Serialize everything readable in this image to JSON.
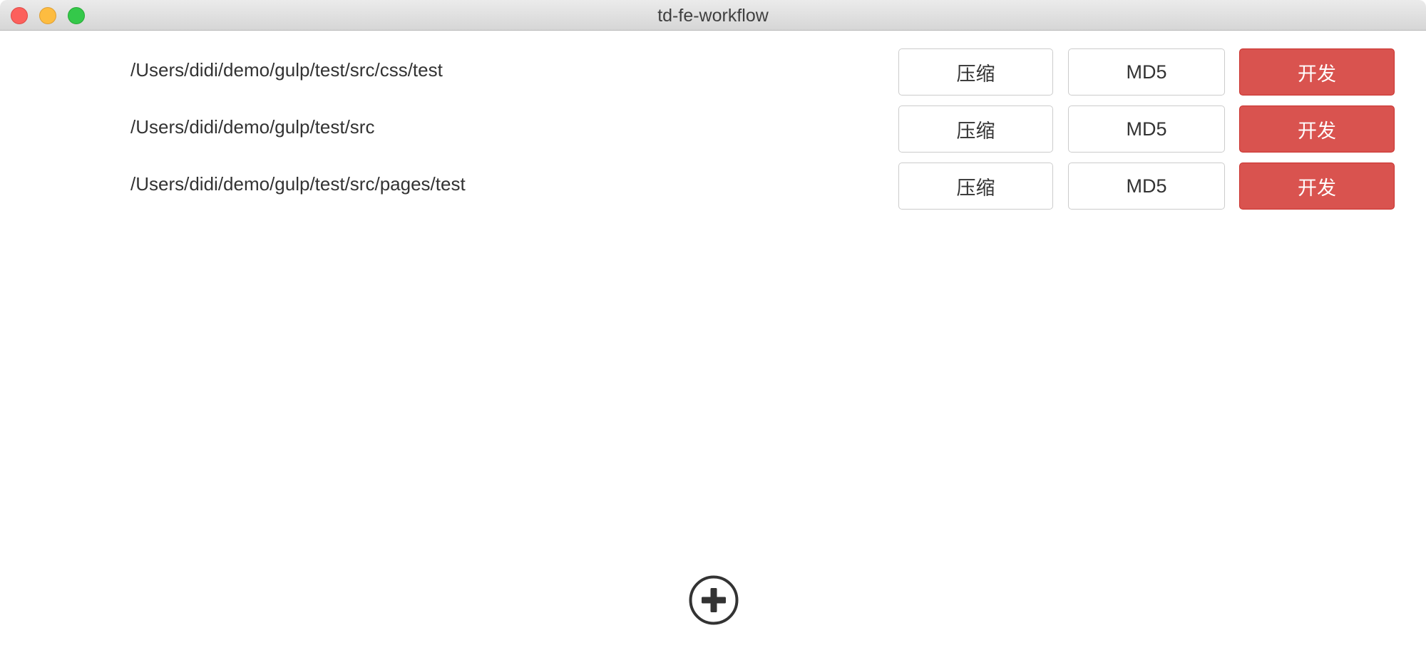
{
  "window": {
    "title": "td-fe-workflow"
  },
  "projects": [
    {
      "path": "/Users/didi/demo/gulp/test/src/css/test",
      "compress_label": "压缩",
      "md5_label": "MD5",
      "dev_label": "开发"
    },
    {
      "path": "/Users/didi/demo/gulp/test/src",
      "compress_label": "压缩",
      "md5_label": "MD5",
      "dev_label": "开发"
    },
    {
      "path": "/Users/didi/demo/gulp/test/src/pages/test",
      "compress_label": "压缩",
      "md5_label": "MD5",
      "dev_label": "开发"
    }
  ],
  "footer": {
    "add_icon": "plus-circle-icon"
  },
  "colors": {
    "danger": "#d9534f",
    "danger_border": "#c9302c",
    "default_border": "#cccccc",
    "text": "#333333"
  }
}
